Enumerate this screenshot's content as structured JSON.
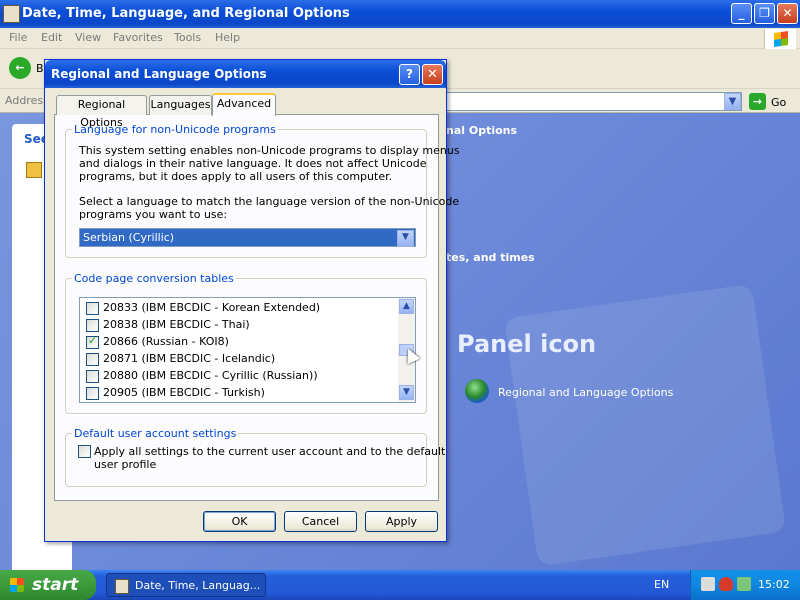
{
  "explorer": {
    "title": "Date, Time, Language, and Regional Options",
    "menu": [
      "File",
      "Edit",
      "View",
      "Favorites",
      "Tools",
      "Help"
    ],
    "back_label": "B",
    "address_label": "Address",
    "go_label": "Go",
    "left_panel_see": "See",
    "bg_heading": "nal Options",
    "bg_task": "tes, and times",
    "bg_panel_icon": "Panel icon",
    "bg_item_label": "Regional and Language Options"
  },
  "dialog": {
    "title": "Regional and Language Options",
    "help_glyph": "?",
    "close_glyph": "✕",
    "tabs": [
      "Regional Options",
      "Languages",
      "Advanced"
    ],
    "active_tab": "Advanced",
    "group1": {
      "legend": "Language for non-Unicode programs",
      "desc1_lines": [
        "This system setting enables non-Unicode programs to display menus",
        "and dialogs in their native language. It does not affect Unicode",
        "programs, but it does apply to all users of this computer."
      ],
      "desc2_lines": [
        "Select a language to match the language version of the non-Unicode",
        "programs you want to use:"
      ],
      "selected_language": "Serbian (Cyrillic)"
    },
    "group2": {
      "legend": "Code page conversion tables",
      "items": [
        {
          "label": "20833 (IBM EBCDIC - Korean Extended)",
          "checked": false
        },
        {
          "label": "20838 (IBM EBCDIC - Thai)",
          "checked": false
        },
        {
          "label": "20866 (Russian - KOI8)",
          "checked": true
        },
        {
          "label": "20871 (IBM EBCDIC - Icelandic)",
          "checked": false
        },
        {
          "label": "20880 (IBM EBCDIC - Cyrillic (Russian))",
          "checked": false
        },
        {
          "label": "20905 (IBM EBCDIC - Turkish)",
          "checked": false
        }
      ],
      "check_glyph": "✓"
    },
    "group3": {
      "legend": "Default user account settings",
      "checkbox_lines": [
        "Apply all settings to the current user account and to the default",
        "user profile"
      ]
    },
    "buttons": {
      "ok": "OK",
      "cancel": "Cancel",
      "apply": "Apply"
    }
  },
  "taskbar": {
    "start_label": "start",
    "task_label": "Date, Time, Languag...",
    "language": "EN",
    "clock": "15:02"
  },
  "colors": {
    "title_blue": "#0a4ed6",
    "selection_blue": "#316ac5",
    "legend_blue": "#0046d5",
    "dialog_bg": "#ece9d8",
    "tab_accent": "#ffc83c",
    "start_green": "#3b9b3b",
    "desktop_blue": "#6b87d8"
  }
}
